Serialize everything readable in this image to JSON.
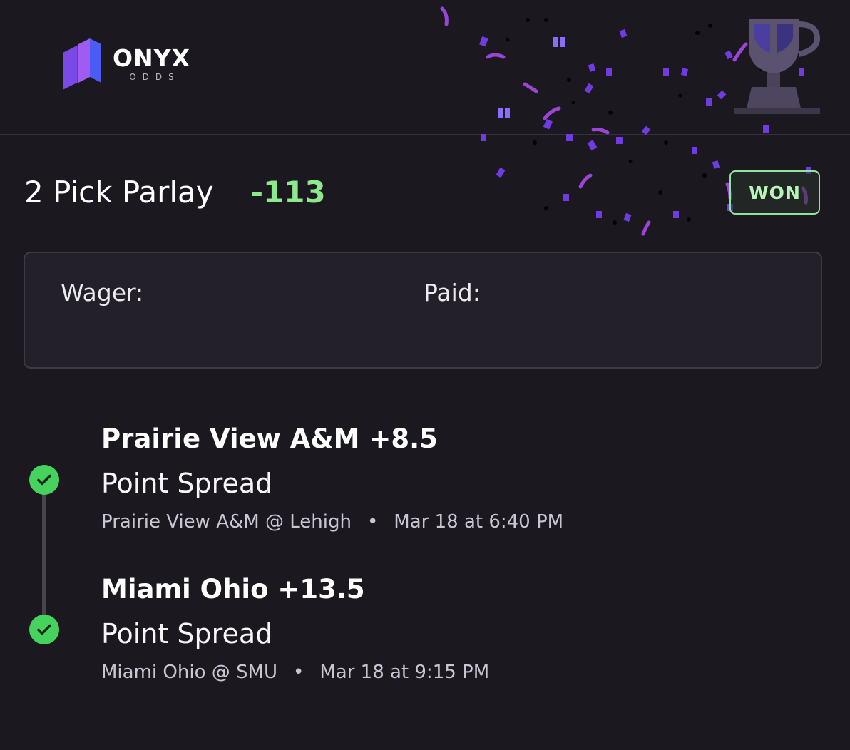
{
  "brand": {
    "name": "ONYX",
    "sub": "ODDS",
    "accent": "#7b5cff"
  },
  "bet": {
    "title": "2 Pick Parlay",
    "odds": "-113",
    "status": "WON",
    "status_color": "#8fe59a"
  },
  "summary": {
    "wager_label": "Wager:",
    "wager_value": "",
    "paid_label": "Paid:",
    "paid_value": ""
  },
  "picks": [
    {
      "name": "Prairie View A&M +8.5",
      "market": "Point Spread",
      "matchup": "Prairie View A&M @ Lehigh",
      "time": "Mar 18 at 6:40 PM",
      "result_icon": "check-icon"
    },
    {
      "name": "Miami Ohio +13.5",
      "market": "Point Spread",
      "matchup": "Miami Ohio @ SMU",
      "time": "Mar 18 at 9:15 PM",
      "result_icon": "check-icon"
    }
  ],
  "decorations": {
    "confetti_colors": [
      "#7b3fe4",
      "#9a45d6",
      "#5b2fc9"
    ],
    "trophy_icon": "trophy-icon"
  }
}
